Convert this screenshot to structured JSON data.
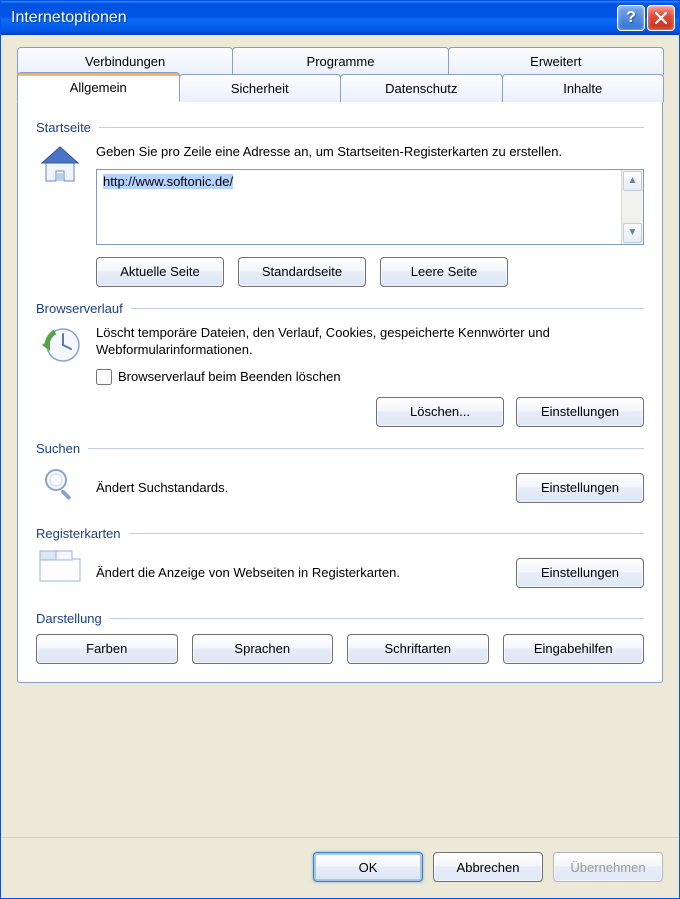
{
  "window": {
    "title": "Internetoptionen"
  },
  "tabs": {
    "row1": [
      "Verbindungen",
      "Programme",
      "Erweitert"
    ],
    "row2": [
      "Allgemein",
      "Sicherheit",
      "Datenschutz",
      "Inhalte"
    ],
    "active": "Allgemein"
  },
  "startpage": {
    "legend": "Startseite",
    "desc": "Geben Sie pro Zeile eine Adresse an, um Startseiten-Registerkarten zu erstellen.",
    "url_value": "http://www.softonic.de/",
    "buttons": {
      "current": "Aktuelle Seite",
      "default": "Standardseite",
      "blank": "Leere Seite"
    }
  },
  "history": {
    "legend": "Browserverlauf",
    "desc": "Löscht temporäre Dateien, den Verlauf, Cookies, gespeicherte Kennwörter und Webformularinformationen.",
    "checkbox_label": "Browserverlauf beim Beenden löschen",
    "checkbox_checked": false,
    "buttons": {
      "delete": "Löschen...",
      "settings": "Einstellungen"
    }
  },
  "search": {
    "legend": "Suchen",
    "desc": "Ändert Suchstandards.",
    "buttons": {
      "settings": "Einstellungen"
    }
  },
  "tabs_section": {
    "legend": "Registerkarten",
    "desc": "Ändert die Anzeige von Webseiten in Registerkarten.",
    "buttons": {
      "settings": "Einstellungen"
    }
  },
  "appearance": {
    "legend": "Darstellung",
    "buttons": {
      "colors": "Farben",
      "languages": "Sprachen",
      "fonts": "Schriftarten",
      "accessibility": "Eingabehilfen"
    }
  },
  "dialog": {
    "ok": "OK",
    "cancel": "Abbrechen",
    "apply": "Übernehmen"
  }
}
